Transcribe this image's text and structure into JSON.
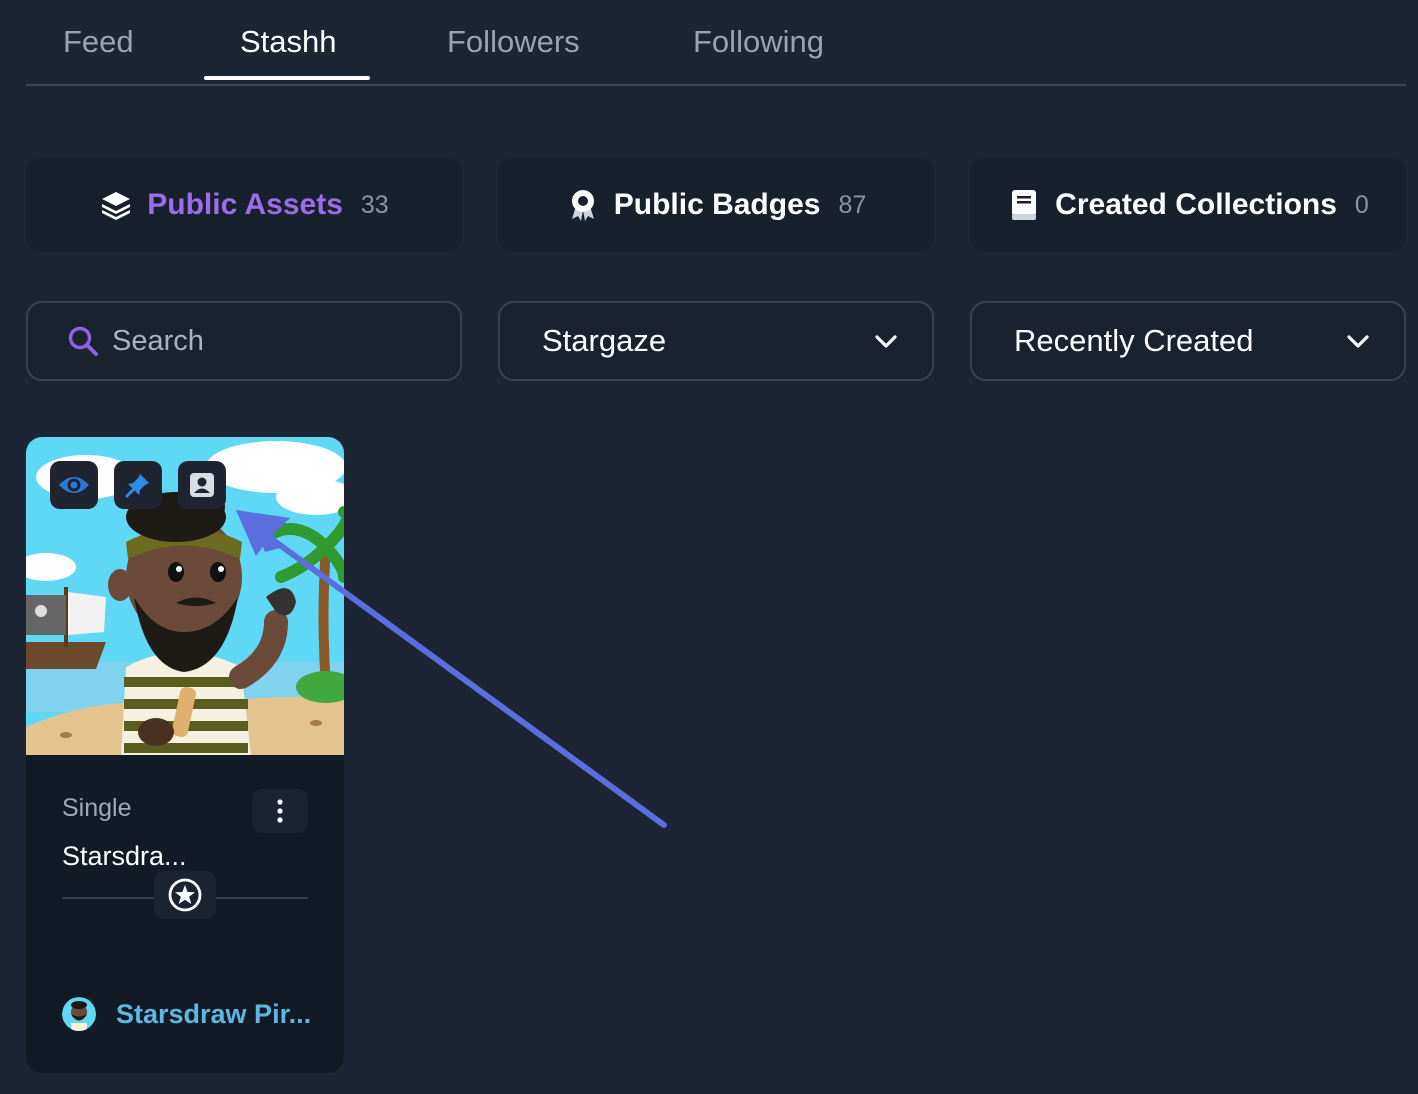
{
  "tabs": [
    {
      "label": "Feed",
      "active": false
    },
    {
      "label": "Stashh",
      "active": true
    },
    {
      "label": "Followers",
      "active": false
    },
    {
      "label": "Following",
      "active": false
    }
  ],
  "categories": [
    {
      "label": "Public Assets",
      "count": "33",
      "icon": "layers-icon",
      "active": true
    },
    {
      "label": "Public Badges",
      "count": "87",
      "icon": "badge-icon",
      "active": false
    },
    {
      "label": "Created Collections",
      "count": "0",
      "icon": "book-icon",
      "active": false
    }
  ],
  "search": {
    "placeholder": "Search",
    "value": ""
  },
  "filters": {
    "chain": "Stargaze",
    "sort": "Recently Created"
  },
  "asset_card": {
    "type": "Single",
    "title": "Starsdra...",
    "creator": "Starsdraw Pir...",
    "actions": [
      "eye-icon",
      "pin-icon",
      "profile-icon"
    ]
  },
  "colors": {
    "background": "#1c2533",
    "accent_purple": "#9b6ee8",
    "creator_link": "#5fb6e0",
    "annotation_arrow": "#5a6ee0"
  }
}
